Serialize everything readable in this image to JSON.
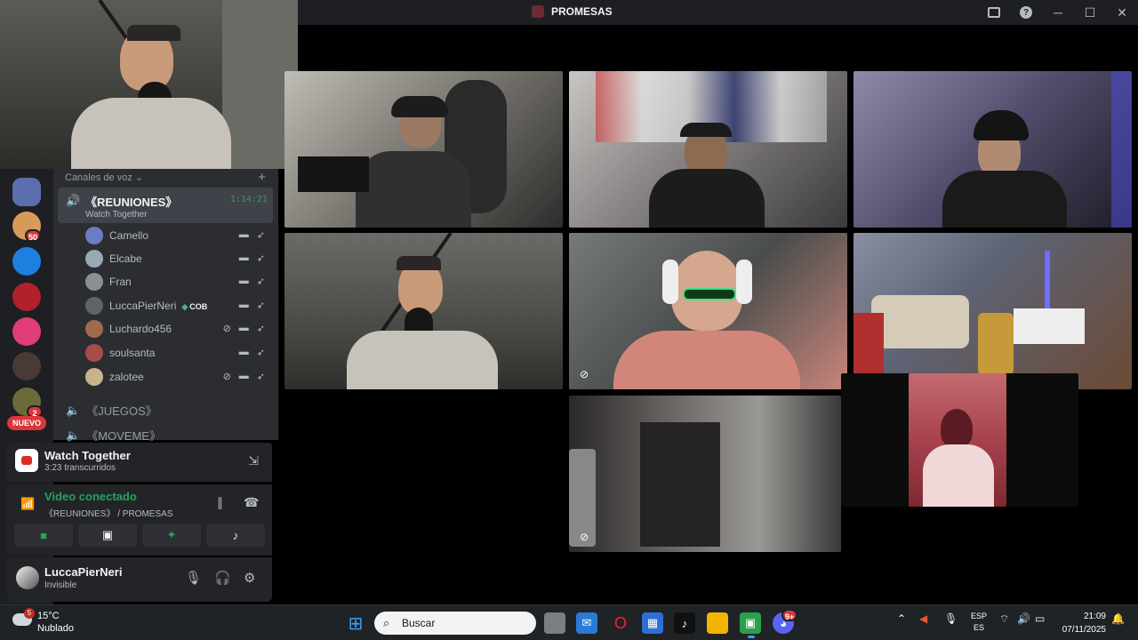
{
  "window": {
    "title": "PROMESAS"
  },
  "channels": {
    "header": "Canales de voz",
    "active": {
      "name": "《REUNIONES》",
      "activity": "Watch Together",
      "timer": "1:14:21"
    },
    "members": [
      {
        "name": "Camello",
        "avatar_color": "#6b7dc2",
        "deafened": false,
        "tag": ""
      },
      {
        "name": "Elcabe",
        "avatar_color": "#9aa9b2",
        "deafened": false,
        "tag": ""
      },
      {
        "name": "Fran",
        "avatar_color": "#8a8f94",
        "deafened": false,
        "tag": ""
      },
      {
        "name": "LuccaPierNeri",
        "avatar_color": "#5f6468",
        "deafened": false,
        "tag": "COB"
      },
      {
        "name": "Luchardo456",
        "avatar_color": "#a06b4a",
        "deafened": true,
        "tag": ""
      },
      {
        "name": "soulsanta",
        "avatar_color": "#a84b4b",
        "deafened": false,
        "tag": ""
      },
      {
        "name": "zalotee",
        "avatar_color": "#c9b38a",
        "deafened": true,
        "tag": ""
      }
    ],
    "others": [
      "《JUEGOS》",
      "《MOVEME》"
    ]
  },
  "rail": {
    "badges": [
      "50",
      "2"
    ],
    "new_label": "NUEVO"
  },
  "watch": {
    "title": "Watch Together",
    "elapsed": "3:23 transcurridos"
  },
  "voice": {
    "status": "Video conectado",
    "location": "《REUNIONES》 / PROMESAS"
  },
  "me": {
    "name": "LuccaPierNeri",
    "status": "Invisible"
  },
  "taskbar": {
    "weather_temp": "15°C",
    "weather_desc": "Nublado",
    "weather_badge": "5",
    "search_placeholder": "Buscar",
    "lang_top": "ESP",
    "lang_bottom": "ES",
    "time": "21:09",
    "date": "07/11/2025",
    "discord_badge": "9+"
  },
  "colors": {
    "voice_green": "#23a559",
    "bg_sidebar": "#2b2d31",
    "bg_rail": "#1e1f22",
    "badge_red": "#da373c"
  }
}
